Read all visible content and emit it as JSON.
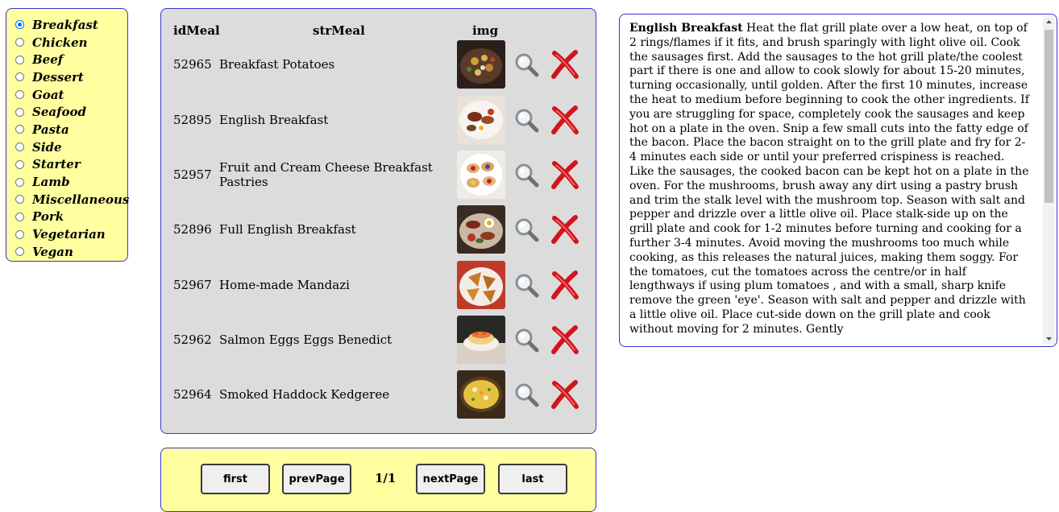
{
  "categories": {
    "selected": "Breakfast",
    "items": [
      "Breakfast",
      "Chicken",
      "Beef",
      "Dessert",
      "Goat",
      "Seafood",
      "Pasta",
      "Side",
      "Starter",
      "Lamb",
      "Miscellaneous",
      "Pork",
      "Vegetarian",
      "Vegan"
    ]
  },
  "table": {
    "headers": {
      "id": "idMeal",
      "name": "strMeal",
      "img": "img"
    },
    "rows": [
      {
        "id": "52965",
        "name": "Breakfast Potatoes"
      },
      {
        "id": "52895",
        "name": "English Breakfast"
      },
      {
        "id": "52957",
        "name": "Fruit and Cream Cheese Breakfast Pastries"
      },
      {
        "id": "52896",
        "name": "Full English Breakfast"
      },
      {
        "id": "52967",
        "name": "Home-made Mandazi"
      },
      {
        "id": "52962",
        "name": "Salmon Eggs Eggs Benedict"
      },
      {
        "id": "52964",
        "name": "Smoked Haddock Kedgeree"
      }
    ]
  },
  "pager": {
    "first": "first",
    "prev": "prevPage",
    "info": "1/1",
    "next": "nextPage",
    "last": "last"
  },
  "detail": {
    "title": "English Breakfast",
    "text": "Heat the flat grill plate over a low heat, on top of 2 rings/flames if it fits, and brush sparingly with light olive oil. Cook the sausages first. Add the sausages to the hot grill plate/the coolest part if there is one and allow to cook slowly for about 15-20 minutes, turning occasionally, until golden. After the first 10 minutes, increase the heat to medium before beginning to cook the other ingredients. If you are struggling for space, completely cook the sausages and keep hot on a plate in the oven. Snip a few small cuts into the fatty edge of the bacon. Place the bacon straight on to the grill plate and fry for 2-4 minutes each side or until your preferred crispiness is reached. Like the sausages, the cooked bacon can be kept hot on a plate in the oven. For the mushrooms, brush away any dirt using a pastry brush and trim the stalk level with the mushroom top. Season with salt and pepper and drizzle over a little olive oil. Place stalk-side up on the grill plate and cook for 1-2 minutes before turning and cooking for a further 3-4 minutes. Avoid moving the mushrooms too much while cooking, as this releases the natural juices, making them soggy. For the tomatoes, cut the tomatoes across the centre/or in half lengthways if using plum tomatoes , and with a small, sharp knife remove the green 'eye'. Season with salt and pepper and drizzle with a little olive oil. Place cut-side down on the grill plate and cook without moving for 2 minutes. Gently"
  },
  "icons": {
    "view": "magnifier-icon",
    "delete": "delete-x-icon"
  },
  "colors": {
    "panel_yellow": "#ffffa0",
    "panel_gray": "#dcdcdc",
    "panel_border": "#3434d6",
    "delete_red": "#d3141b",
    "radio_blue": "#0075ff"
  }
}
